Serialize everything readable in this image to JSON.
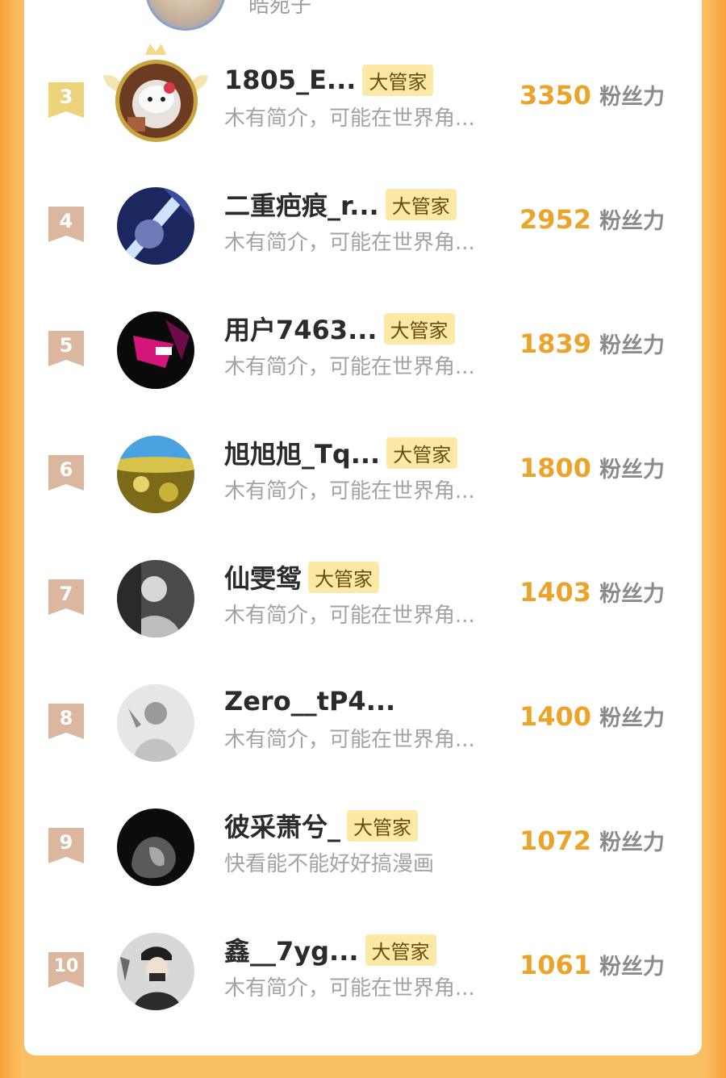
{
  "top_partial": {
    "name": "皓宛子"
  },
  "unit_label": "粉丝力",
  "badge_label": "大管家",
  "colors": {
    "score": "#eca32a",
    "badge_bg": "#fde9a6",
    "rank_top": "#ecd27a",
    "rank_normal": "#dcb7a0",
    "frame": "#fbbf63"
  },
  "rows": [
    {
      "rank": "3",
      "name": "1805_E...",
      "badge": "大管家",
      "bio": "木有简介，可能在世界角...",
      "score": "3350",
      "avatar": "hello-kitty-avatar"
    },
    {
      "rank": "4",
      "name": "二重疤痕_r...",
      "badge": "大管家",
      "bio": "木有简介，可能在世界角...",
      "score": "2952",
      "avatar": "anime-blue-avatar"
    },
    {
      "rank": "5",
      "name": "用户7463...",
      "badge": "大管家",
      "bio": "木有简介，可能在世界角...",
      "score": "1839",
      "avatar": "dark-pink-avatar"
    },
    {
      "rank": "6",
      "name": "旭旭旭_Tq...",
      "badge": "大管家",
      "bio": "木有简介，可能在世界角...",
      "score": "1800",
      "avatar": "golden-field-avatar"
    },
    {
      "rank": "7",
      "name": "仙雯鸳",
      "badge": "大管家",
      "bio": "木有简介，可能在世界角...",
      "score": "1403",
      "avatar": "gray-person-avatar"
    },
    {
      "rank": "8",
      "name": "Zero__tP4...",
      "badge": "",
      "bio": "木有简介，可能在世界角...",
      "score": "1400",
      "avatar": "light-gray-avatar"
    },
    {
      "rank": "9",
      "name": "彼采萧兮_",
      "badge": "大管家",
      "bio": "快看能不能好好搞漫画",
      "score": "1072",
      "avatar": "lion-avatar"
    },
    {
      "rank": "10",
      "name": "鑫__7yg...",
      "badge": "大管家",
      "bio": "木有简介，可能在世界角...",
      "score": "1061",
      "avatar": "boy-cap-avatar"
    }
  ]
}
